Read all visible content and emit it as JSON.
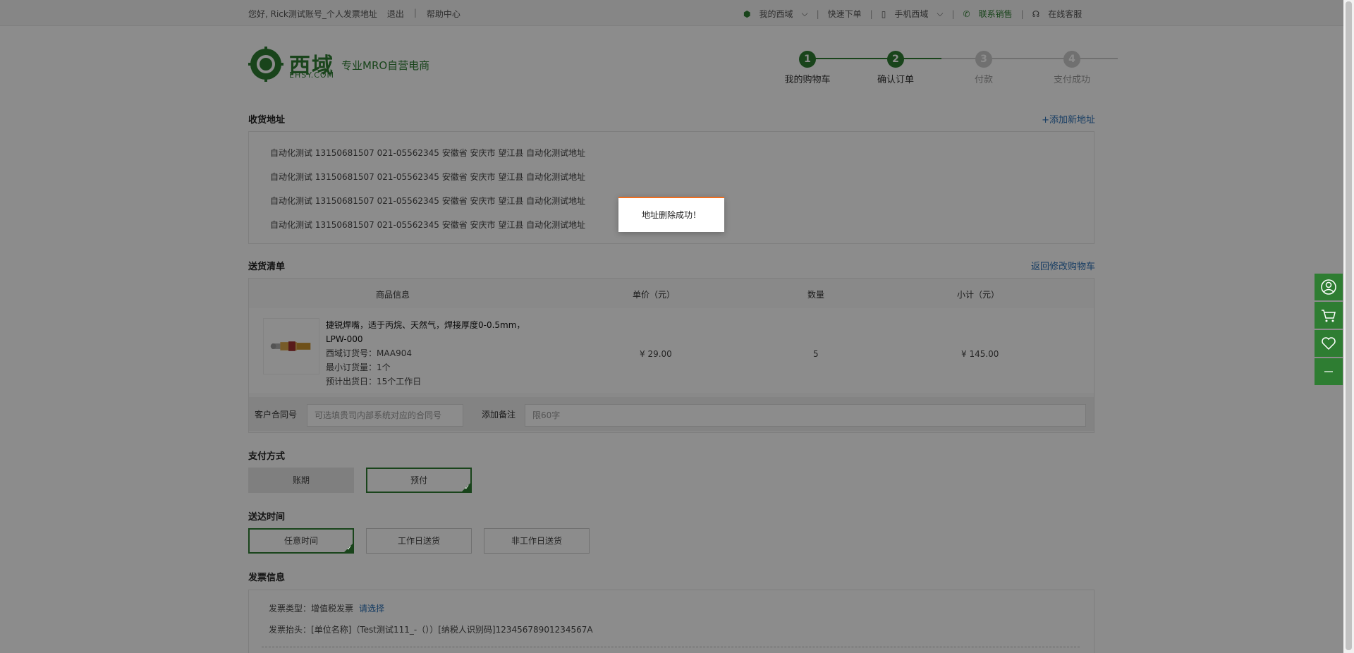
{
  "topbar": {
    "greeting": "您好, Rick测试账号_个人发票地址",
    "logout": "退出",
    "divider": "|",
    "help": "帮助中心",
    "my_account": "我的西域",
    "quick_order": "快速下单",
    "mobile": "手机西域",
    "contact_sales": "联系销售",
    "online_service": "在线客服"
  },
  "brand": {
    "name_cn": "西域",
    "name_en": "EHSY.COM",
    "slogan": "专业MRO自营电商"
  },
  "steps": [
    {
      "num": "1",
      "label": "我的购物车"
    },
    {
      "num": "2",
      "label": "确认订单"
    },
    {
      "num": "3",
      "label": "付款"
    },
    {
      "num": "4",
      "label": "支付成功"
    }
  ],
  "address": {
    "title": "收货地址",
    "add_link": "+添加新地址",
    "rows": [
      "自动化测试  13150681507 021-05562345 安徽省 安庆市 望江县 自动化测试地址",
      "自动化测试  13150681507 021-05562345 安徽省 安庆市 望江县 自动化测试地址",
      "自动化测试  13150681507 021-05562345 安徽省 安庆市 望江县 自动化测试地址",
      "自动化测试  13150681507 021-05562345 安徽省 安庆市 望江县 自动化测试地址"
    ]
  },
  "delivery_list": {
    "title": "送货清单",
    "back_link": "返回修改购物车",
    "headers": {
      "product": "商品信息",
      "price": "单价（元）",
      "qty": "数量",
      "subtotal": "小计（元）"
    },
    "product": {
      "name": "捷锐焊嘴，适于丙烷、天然气，焊接厚度0-0.5mm，",
      "model": "LPW-000",
      "order_no": "西域订货号：MAA904",
      "min_qty": "最小订货量：1个",
      "ship_days": "预计出货日：15个工作日",
      "price": "¥ 29.00",
      "qty": "5",
      "subtotal": "¥ 145.00"
    },
    "contract_label": "客户合同号",
    "contract_placeholder": "可选填贵司内部系统对应的合同号",
    "remark_label": "添加备注",
    "remark_placeholder": "限60字"
  },
  "payment": {
    "title": "支付方式",
    "options": [
      "账期",
      "预付"
    ]
  },
  "delivery_time": {
    "title": "送达时间",
    "options": [
      "任意时间",
      "工作日送货",
      "非工作日送货"
    ]
  },
  "invoice": {
    "title": "发票信息",
    "type_label": "发票类型：",
    "type_value": "增值税发票",
    "choose": "请选择",
    "header_label": "发票抬头：",
    "header_value": "[单位名称]（Test测试111_-（））[纳税人识别码]12345678901234567A"
  },
  "toast": {
    "message": "地址删除成功！"
  },
  "colors": {
    "brand_green": "#2e7d32",
    "link_blue": "#2a6fb5",
    "toast_accent": "#f06e1e"
  }
}
